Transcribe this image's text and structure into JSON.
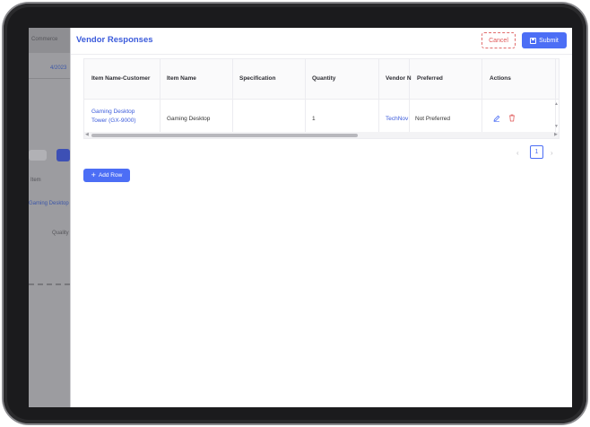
{
  "background_page": {
    "top_label": "Commerce",
    "breadcrumb_tail": "4/2023",
    "row_label": "Item",
    "link_text": "Gaming Desktop Tow",
    "column_label": "Quality"
  },
  "drawer": {
    "title": "Vendor Responses",
    "cancel_label": "Cancel",
    "submit_label": "Submit"
  },
  "table": {
    "columns": [
      "Item Name-Customer",
      "Item Name",
      "Specification",
      "Quantity",
      "Vendor N",
      "Preferred",
      "Actions"
    ],
    "rows": [
      {
        "item_name_customer_line1": "Gaming Desktop",
        "item_name_customer_line2": "Tower (GX-9000)",
        "item_name": "Gaming Desktop",
        "specification": "",
        "quantity": "1",
        "vendor_name": "TechNov",
        "preferred": "Not Preferred"
      }
    ]
  },
  "pagination": {
    "current_page": "1"
  },
  "add_row_label": "Add Row",
  "colors": {
    "primary": "#4c6ef5",
    "title": "#3b5bdb",
    "danger": "#e05858",
    "frame": "#1b1b1d"
  },
  "icons": [
    "submit-icon",
    "edit-icon",
    "delete-icon",
    "plus-icon",
    "chevron-left-icon",
    "chevron-right-icon"
  ]
}
